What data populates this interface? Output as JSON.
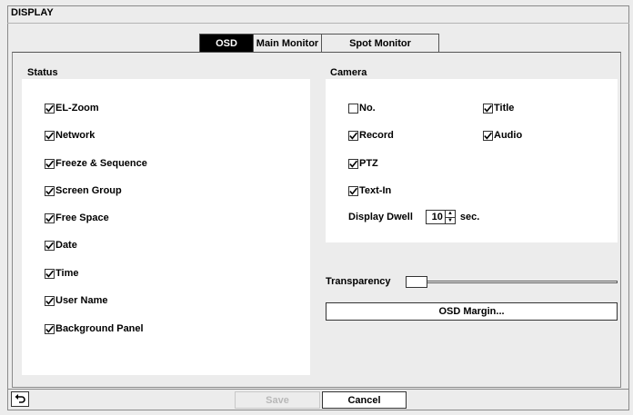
{
  "window": {
    "title": "DISPLAY"
  },
  "tabs": [
    {
      "label": "OSD",
      "active": true
    },
    {
      "label": "Main Monitor",
      "active": false
    },
    {
      "label": "Spot Monitor",
      "active": false
    }
  ],
  "status": {
    "label": "Status",
    "items": [
      {
        "label": "EL-Zoom",
        "checked": true
      },
      {
        "label": "Network",
        "checked": true
      },
      {
        "label": "Freeze & Sequence",
        "checked": true
      },
      {
        "label": "Screen Group",
        "checked": true
      },
      {
        "label": "Free Space",
        "checked": true
      },
      {
        "label": "Date",
        "checked": true
      },
      {
        "label": "Time",
        "checked": true
      },
      {
        "label": "User Name",
        "checked": true
      },
      {
        "label": "Background Panel",
        "checked": true
      }
    ]
  },
  "camera": {
    "label": "Camera",
    "items": [
      {
        "label": "No.",
        "checked": false
      },
      {
        "label": "Title",
        "checked": true
      },
      {
        "label": "Record",
        "checked": true
      },
      {
        "label": "Audio",
        "checked": true
      },
      {
        "label": "PTZ",
        "checked": true
      },
      {
        "label": "Text-In",
        "checked": true
      }
    ],
    "display_dwell": {
      "label": "Display Dwell",
      "value": "10",
      "unit": "sec."
    }
  },
  "transparency": {
    "label": "Transparency",
    "level": 0
  },
  "osd_margin_label": "OSD Margin...",
  "footer": {
    "save_label": "Save",
    "cancel_label": "Cancel",
    "back_icon": "back-arrow-icon"
  }
}
